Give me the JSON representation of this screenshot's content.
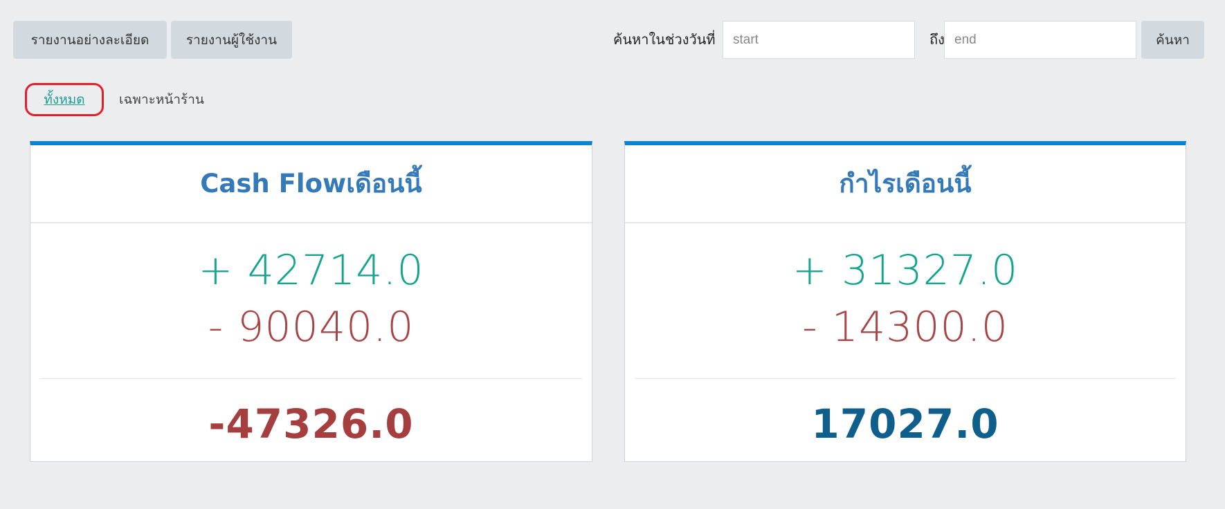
{
  "toolbar": {
    "detail_report_label": "รายงานอย่างละเอียด",
    "user_report_label": "รายงานผู้ใช้งาน",
    "search_range_label": "ค้นหาในช่วงวันที่",
    "start_placeholder": "start",
    "to_label": "ถึง",
    "end_placeholder": "end",
    "search_button_label": "ค้นหา"
  },
  "filters": {
    "all_label": "ทั้งหมด",
    "storefront_label": "เฉพาะหน้าร้าน",
    "selected": "all",
    "highlight_color": "#e11e2a"
  },
  "cards": {
    "cashflow": {
      "title": "Cash Flowเดือนนี้",
      "income": "+ 42714.0",
      "expense": "- 90040.0",
      "total": "-47326.0"
    },
    "profit": {
      "title": "กำไรเดือนนี้",
      "income": "+ 31327.0",
      "expense": "- 14300.0",
      "total": "17027.0"
    }
  },
  "colors": {
    "accent": "#0a84d0",
    "positive": "#15a58f",
    "negative": "#a84545",
    "title": "#347ab8",
    "total_positive": "#0f5f8c"
  }
}
